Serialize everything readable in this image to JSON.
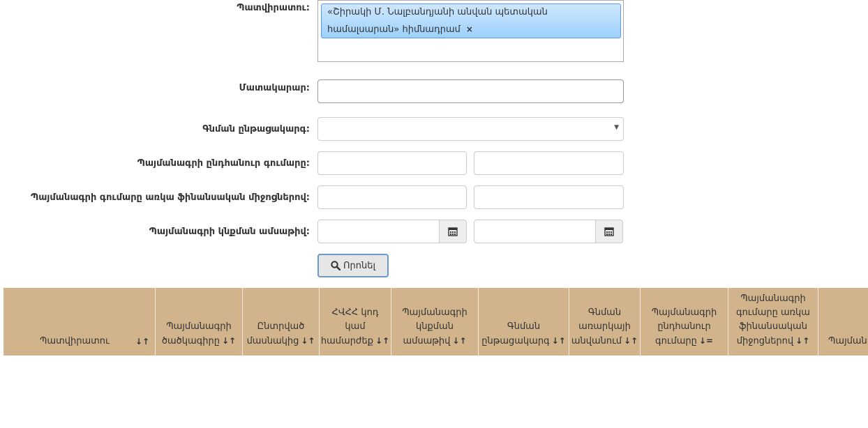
{
  "form": {
    "university_label": "Պատվիրատու:",
    "university_chip": "«Շիրակի Մ. Նալբանդյանի անվան պետական համալսարան» հիմնադրամ",
    "chip_remove": "×",
    "supplier_label": "Մատակարար:",
    "supplier_value": "",
    "procurement_label": "Գնման ընթացակարգ:",
    "procurement_selected": "",
    "contract_total_label": "Պայմանագրի ընդհանուր գումարը:",
    "contract_available_label": "Պայմանագրի գումարը առկա ֆինանսական միջոցներով:",
    "contract_date_label": "Պայմանագրի կնքման ամսաթիվ:",
    "search_button": "Որոնել"
  },
  "icons": {
    "search": "search-icon",
    "calendar": "calendar-icon",
    "dropdown": "chevron-down-icon",
    "sort": "sort-icon",
    "remove": "close-icon"
  },
  "table": {
    "headers": [
      {
        "label": "Պատվիրատու",
        "sort": "↓↑"
      },
      {
        "label": "Պայմանագրի ծածկագիրը",
        "sort": "↓↑"
      },
      {
        "label": "Ընտրված մասնակից",
        "sort": "↓↑"
      },
      {
        "label": "ՀՎՀՀ կոդ կամ համարժեք",
        "sort": "↓↑"
      },
      {
        "label": "Պայմանագրի կնքման ամսաթիվ",
        "sort": "↓↑"
      },
      {
        "label": "Գնման ընթացակարգ",
        "sort": "↓↑"
      },
      {
        "label": "Գնման առարկայի անվանում",
        "sort": "↓↑"
      },
      {
        "label": "Պայմանագրի ընդհանուր գումարը",
        "sort": "↓="
      },
      {
        "label": "Պայմանագրի գումարը առկա ֆինանսական միջոցներով",
        "sort": "↓↑"
      },
      {
        "label": "Պայման",
        "sort": ""
      }
    ]
  },
  "colors": {
    "table_header_bg": "#d2b48c",
    "chip_border": "#5897fb",
    "button_border": "#6a98c8"
  }
}
